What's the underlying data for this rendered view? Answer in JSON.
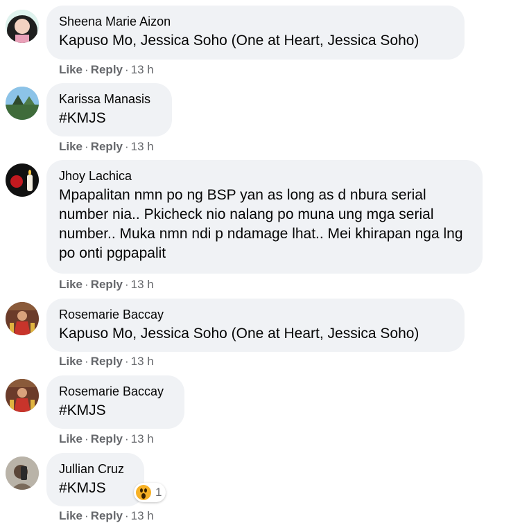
{
  "actions": {
    "like": "Like",
    "reply": "Reply",
    "separator": "·"
  },
  "comments": [
    {
      "author": "Sheena Marie Aizon",
      "text": "Kapuso Mo, Jessica Soho (One at Heart, Jessica Soho)",
      "time": "13 h"
    },
    {
      "author": "Karissa Manasis",
      "text": "#KMJS",
      "time": "13 h"
    },
    {
      "author": "Jhoy Lachica",
      "text": "Mpapalitan nmn po ng BSP yan as long as d nbura serial number nia.. Pkicheck nio nalang po muna ung mga serial number.. Muka nmn ndi p ndamage lhat.. Mei khirapan nga lng po onti pgpapalit",
      "time": "13 h"
    },
    {
      "author": "Rosemarie Baccay",
      "text": "Kapuso Mo, Jessica Soho (One at Heart, Jessica Soho)",
      "time": "13 h"
    },
    {
      "author": "Rosemarie Baccay",
      "text": "#KMJS",
      "time": "13 h"
    },
    {
      "author": "Jullian Cruz",
      "text": "#KMJS",
      "time": "13 h",
      "reaction": {
        "icon": "wow-reaction-icon",
        "count": "1"
      }
    }
  ]
}
